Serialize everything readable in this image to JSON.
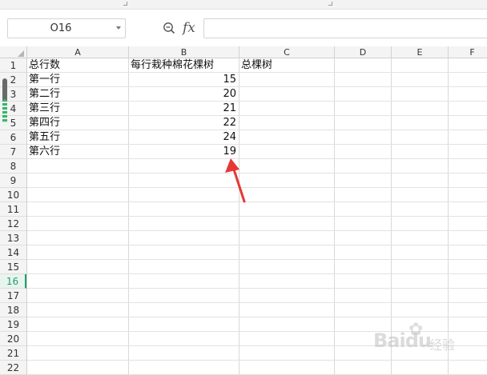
{
  "name_box": {
    "value": "O16"
  },
  "formula_bar": {
    "fx_label": "fx",
    "value": ""
  },
  "columns": [
    "A",
    "B",
    "C",
    "D",
    "E",
    "F"
  ],
  "rows": [
    "1",
    "2",
    "3",
    "4",
    "5",
    "6",
    "7",
    "8",
    "9",
    "10",
    "11",
    "12",
    "13",
    "14",
    "15",
    "16",
    "17",
    "18",
    "19",
    "20",
    "21",
    "22"
  ],
  "active_row": "16",
  "cells": {
    "A1": "总行数",
    "B1": "每行栽种棉花棵树",
    "C1": "总棵树",
    "A2": "第一行",
    "B2": "15",
    "A3": "第二行",
    "B3": "20",
    "A4": "第三行",
    "B4": "21",
    "A5": "第四行",
    "B5": "22",
    "A6": "第五行",
    "B6": "24",
    "A7": "第六行",
    "B7": "19"
  },
  "annotation": {
    "color": "#e53935"
  },
  "watermark": {
    "text": "Baidu",
    "sub": "经验"
  },
  "colors": {
    "accent": "#1f9f68"
  }
}
